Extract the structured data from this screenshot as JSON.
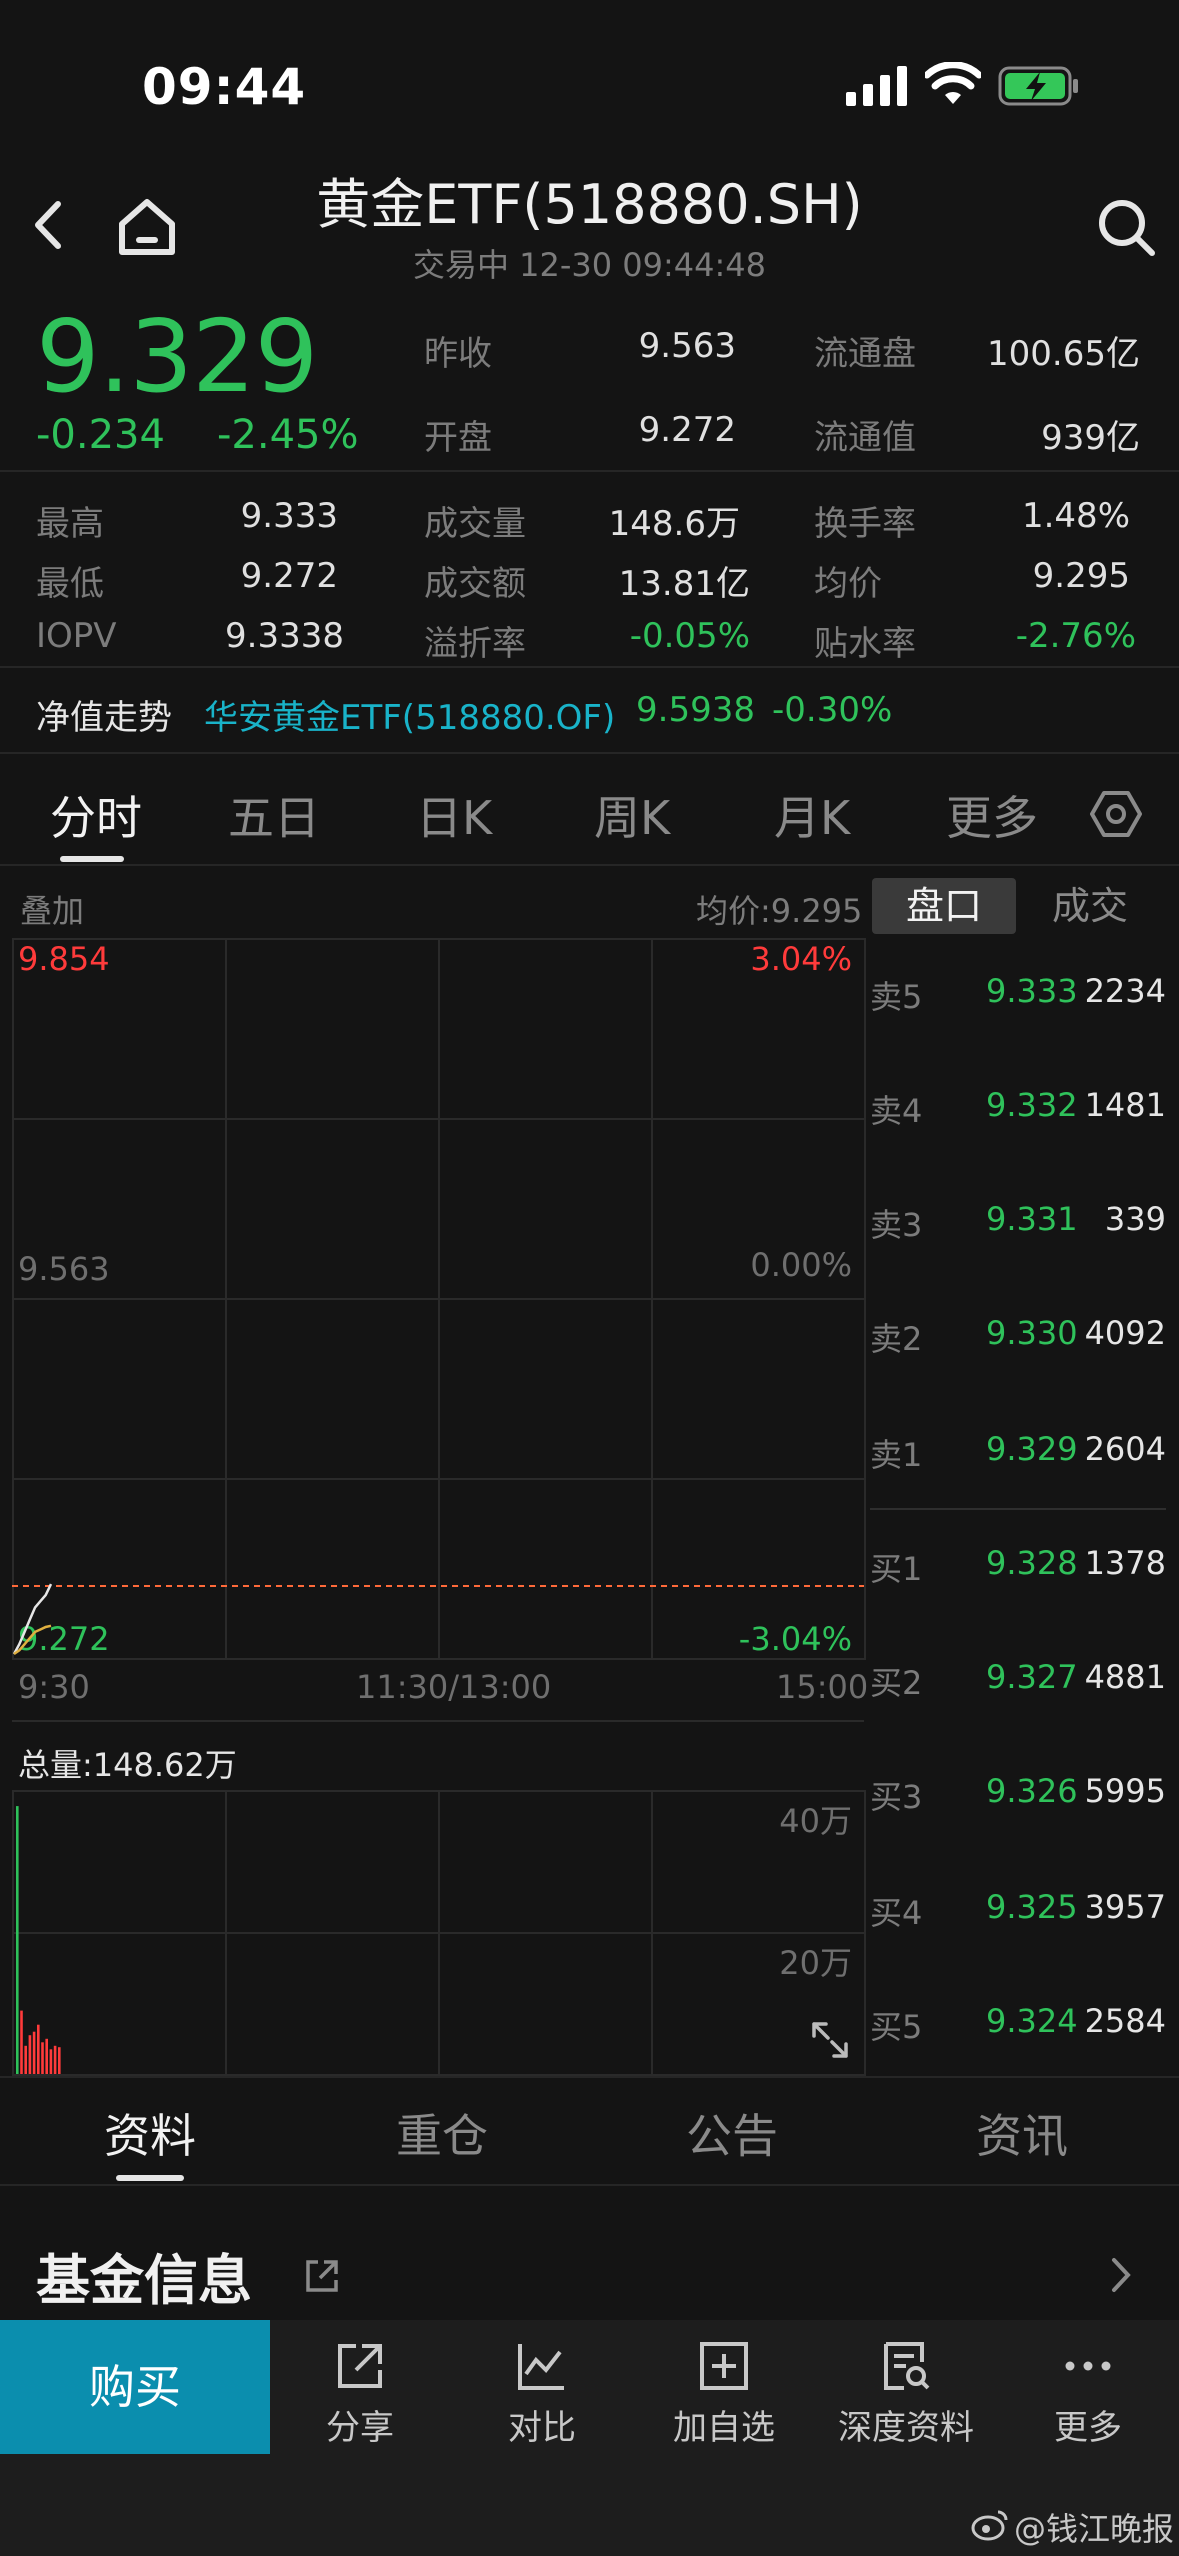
{
  "status_bar": {
    "time": "09:44"
  },
  "header": {
    "title": "黄金ETF(518880.SH)",
    "subtitle": "交易中  12-30 09:44:48"
  },
  "quote": {
    "price": "9.329",
    "change": "-0.234",
    "change_pct": "-2.45%",
    "stats": [
      {
        "label": "昨收",
        "value": "9.563"
      },
      {
        "label": "流通盘",
        "value": "100.65亿"
      },
      {
        "label": "开盘",
        "value": "9.272"
      },
      {
        "label": "流通值",
        "value": "939亿"
      }
    ],
    "grid": [
      {
        "label": "最高",
        "value": "9.333"
      },
      {
        "label": "成交量",
        "value": "148.6万"
      },
      {
        "label": "换手率",
        "value": "1.48%"
      },
      {
        "label": "最低",
        "value": "9.272"
      },
      {
        "label": "成交额",
        "value": "13.81亿"
      },
      {
        "label": "均价",
        "value": "9.295"
      },
      {
        "label": "IOPV",
        "value": "9.3338"
      },
      {
        "label": "溢折率",
        "value": "-0.05%"
      },
      {
        "label": "贴水率",
        "value": "-2.76%"
      }
    ]
  },
  "nav_row": {
    "label": "净值走势",
    "fund": "华安黄金ETF(518880.OF)",
    "value": "9.5938",
    "change": "-0.30%"
  },
  "period_tabs": [
    "分时",
    "五日",
    "日K",
    "周K",
    "月K",
    "更多"
  ],
  "chart": {
    "overlay_label": "叠加",
    "avg_price": "均价:9.295",
    "y_top": "9.854",
    "y_mid": "9.563",
    "y_bot": "9.272",
    "pct_top": "3.04%",
    "pct_mid": "0.00%",
    "pct_bot": "-3.04%",
    "time_start": "9:30",
    "time_mid": "11:30/13:00",
    "time_end": "15:00",
    "volume_total": "总量:148.62万",
    "vol_tick_high": "40万",
    "vol_tick_low": "20万"
  },
  "chart_data": {
    "type": "line",
    "title": "",
    "xlabel": "",
    "ylabel": "",
    "x_range": [
      "9:30",
      "15:00"
    ],
    "ylim": [
      9.272,
      9.854
    ],
    "series": [
      {
        "values": [
          9.272,
          9.28,
          9.29,
          9.3,
          9.31,
          9.315,
          9.32,
          9.329
        ]
      },
      {
        "values": [
          9.272,
          9.275,
          9.28,
          9.285,
          9.29,
          9.292,
          9.294,
          9.295
        ]
      }
    ],
    "volume": {
      "type": "bar",
      "ylim": [
        0,
        400000
      ],
      "values": [
        380000,
        90000,
        40000,
        55000,
        60000,
        70000,
        45000,
        50000,
        35000,
        40000,
        38000
      ]
    }
  },
  "orderbook": {
    "tabs": [
      "盘口",
      "成交"
    ],
    "rows": [
      {
        "side": "卖5",
        "price": "9.333",
        "volume": "2234"
      },
      {
        "side": "卖4",
        "price": "9.332",
        "volume": "1481"
      },
      {
        "side": "卖3",
        "price": "9.331",
        "volume": "339"
      },
      {
        "side": "卖2",
        "price": "9.330",
        "volume": "4092"
      },
      {
        "side": "卖1",
        "price": "9.329",
        "volume": "2604"
      },
      {
        "side": "买1",
        "price": "9.328",
        "volume": "1378"
      },
      {
        "side": "买2",
        "price": "9.327",
        "volume": "4881"
      },
      {
        "side": "买3",
        "price": "9.326",
        "volume": "5995"
      },
      {
        "side": "买4",
        "price": "9.325",
        "volume": "3957"
      },
      {
        "side": "买5",
        "price": "9.324",
        "volume": "2584"
      }
    ]
  },
  "info_tabs": [
    "资料",
    "重仓",
    "公告",
    "资讯"
  ],
  "fund_info_title": "基金信息",
  "bottom_bar": {
    "buy": "购买",
    "items": [
      "分享",
      "对比",
      "加自选",
      "深度资料",
      "更多"
    ]
  },
  "watermark": "@钱江晚报",
  "colors": {
    "up": "#ff3b3b",
    "down": "#2fc25b",
    "accent": "#0b8eae",
    "link": "#19b3c9"
  }
}
